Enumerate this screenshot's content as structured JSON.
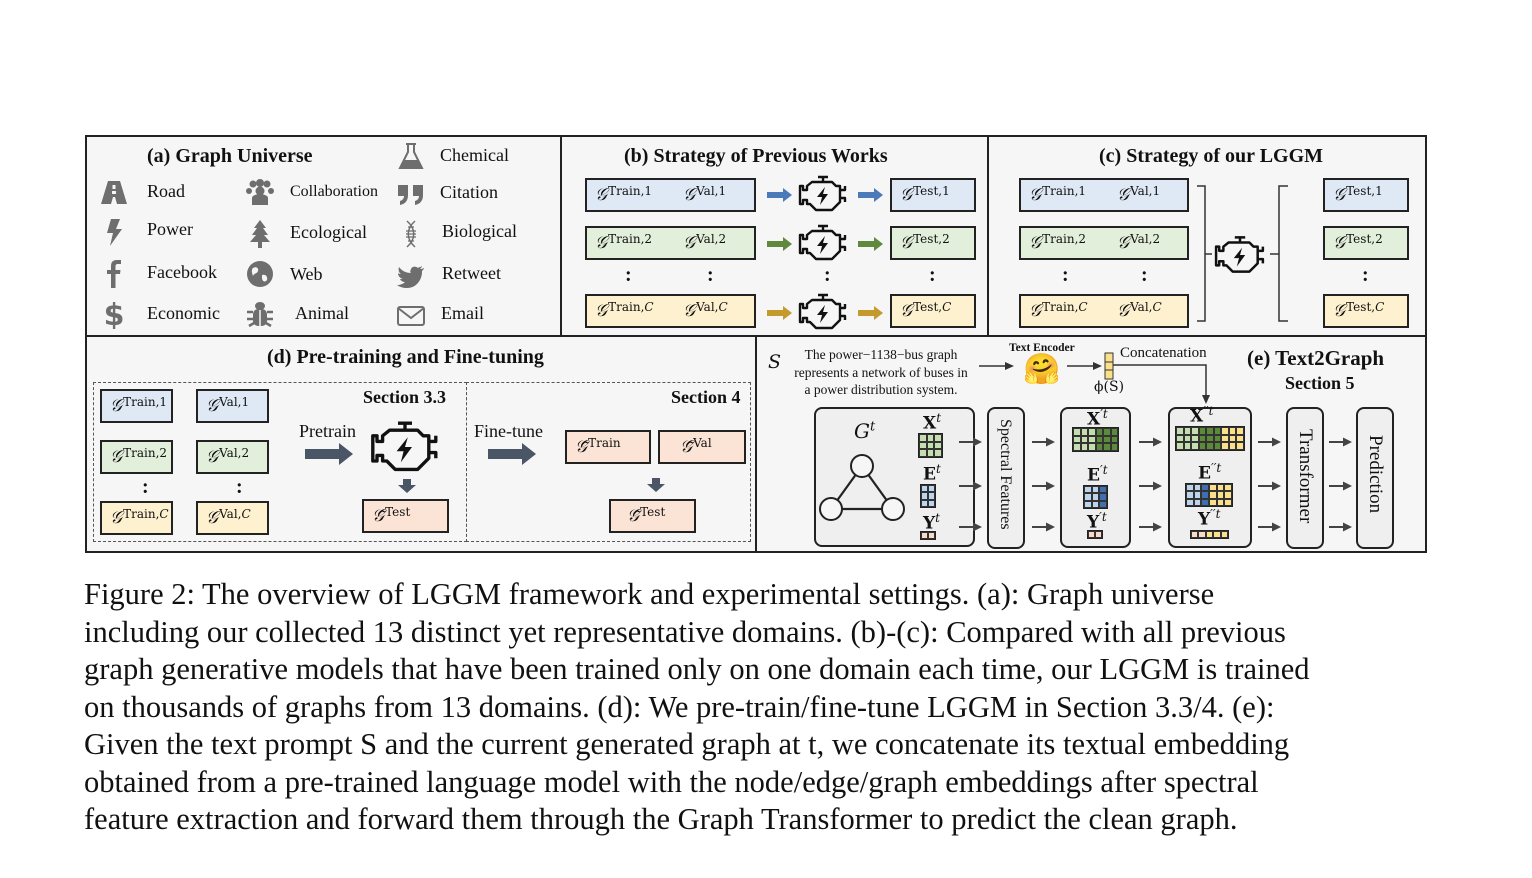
{
  "figure": {
    "panel_a": {
      "title": "(a) Graph Universe",
      "domains": [
        {
          "label": "Road",
          "icon": "road-icon"
        },
        {
          "label": "Power",
          "icon": "lightning-icon"
        },
        {
          "label": "Facebook",
          "icon": "facebook-icon"
        },
        {
          "label": "Economic",
          "icon": "dollar-icon"
        },
        {
          "label": "Collaboration",
          "icon": "users-group-icon"
        },
        {
          "label": "Ecological",
          "icon": "tree-icon"
        },
        {
          "label": "Web",
          "icon": "globe-icon"
        },
        {
          "label": "Animal",
          "icon": "bug-icon"
        },
        {
          "label": "Chemical",
          "icon": "flask-icon"
        },
        {
          "label": "Citation",
          "icon": "quote-icon"
        },
        {
          "label": "Biological",
          "icon": "dna-icon"
        },
        {
          "label": "Retweet",
          "icon": "twitter-bird-icon"
        },
        {
          "label": "Email",
          "icon": "envelope-icon"
        }
      ]
    },
    "panel_b": {
      "title": "(b) Strategy of Previous Works",
      "rows": [
        {
          "train": "Train,1",
          "val": "Val,1",
          "test": "Test,1",
          "color": "#4a7ab8"
        },
        {
          "train": "Train,2",
          "val": "Val,2",
          "test": "Test,2",
          "color": "#5f8a3e"
        },
        {
          "train": "Train,",
          "train_var": "C",
          "val": "Val,",
          "val_var": "C",
          "test": "Test,",
          "test_var": "C",
          "color": "#c49a2c"
        }
      ],
      "ellipsis": ":"
    },
    "panel_c": {
      "title": "(c) Strategy of our LGGM",
      "rows": [
        {
          "train": "Train,1",
          "val": "Val,1",
          "test": "Test,1"
        },
        {
          "train": "Train,2",
          "val": "Val,2",
          "test": "Test,2"
        },
        {
          "train": "Train,",
          "train_var": "C",
          "val": "Val,",
          "val_var": "C",
          "test": "Test,",
          "test_var": "C"
        }
      ],
      "ellipsis": ":"
    },
    "panel_d": {
      "title": "(d) Pre-training and Fine-tuning",
      "section_left": "Section 3.3",
      "section_right": "Section 4",
      "pretrain_label": "Pretrain",
      "finetune_label": "Fine-tune",
      "rows": [
        {
          "train": "Train,1",
          "val": "Val,1"
        },
        {
          "train": "Train,2",
          "val": "Val,2"
        },
        {
          "train": "Train,",
          "train_var": "C",
          "val": "Val,",
          "val_var": "C"
        }
      ],
      "pretest": "Test",
      "ft_train": "Train",
      "ft_val": "Val",
      "ft_test": "Test",
      "ellipsis": ":"
    },
    "panel_e": {
      "title": "(e) Text2Graph",
      "subtitle": "Section 5",
      "prompt_symbol": "S",
      "prompt_lines": [
        "The power−1138−bus graph",
        "represents a network of buses in",
        "a power distribution system."
      ],
      "text_encoder_label": "Text Encoder",
      "encoder_emoji": "🤗",
      "embedding_label": "ϕ(S)",
      "concat_label": "Concatenation",
      "graph_label": "G",
      "graph_sup": "t",
      "x_label": "X",
      "x_sup": "t",
      "e_label": "E",
      "e_sup": "t",
      "y_label": "Y",
      "y_sup": "t",
      "xp_sup": "′t",
      "ep_sup": "′t",
      "yp_sup": "′t",
      "xpp_sup": "′′t",
      "epp_sup": "′′t",
      "ypp_sup": "′′t",
      "spectral_label": "Spectral Features",
      "transformer_label": "Transformer",
      "prediction_label": "Prediction"
    }
  },
  "caption": {
    "lines": [
      "Figure 2:  The overview of LGGM framework and experimental settings.  (a):  Graph universe",
      "including our collected 13 distinct yet representative domains. (b)-(c): Compared with all previous",
      "graph generative models that have been trained only on one domain each time, our LGGM is trained",
      "on thousands of graphs from 13 domains. (d): We pre-train/fine-tune LGGM in Section 3.3/4. (e):",
      "Given the text prompt S and the current generated graph at t, we concatenate its textual embedding",
      "obtained from a pre-trained language model with the node/edge/graph embeddings after spectral",
      "feature extraction and forward them through the Graph Transformer to predict the clean graph."
    ]
  },
  "colors": {
    "blue_fill": "#dfe9f5",
    "green_fill": "#e2efda",
    "yellow_fill": "#fdf1cf",
    "peach_fill": "#fbe4d6",
    "arrow_dark": "#4a5566",
    "icon_gray": "#6e6e6e"
  }
}
